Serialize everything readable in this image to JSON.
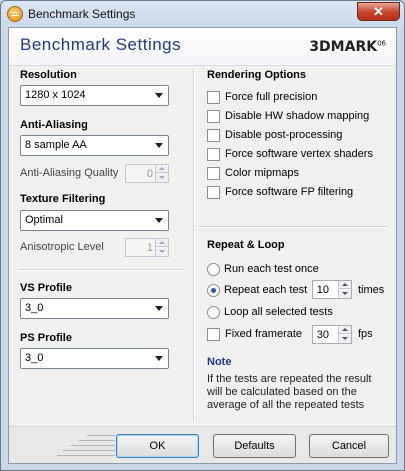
{
  "window": {
    "title": "Benchmark Settings",
    "close_label": "✕"
  },
  "header": {
    "title": "Benchmark Settings",
    "logo_main": "3DMARK",
    "logo_version": "06"
  },
  "left": {
    "resolution": {
      "label": "Resolution",
      "value": "1280 x 1024"
    },
    "anti_aliasing": {
      "label": "Anti-Aliasing",
      "value": "8 sample AA",
      "quality_label": "Anti-Aliasing Quality",
      "quality_value": "0"
    },
    "texture_filtering": {
      "label": "Texture Filtering",
      "value": "Optimal",
      "aniso_label": "Anisotropic Level",
      "aniso_value": "1"
    },
    "vs_profile": {
      "label": "VS Profile",
      "value": "3_0"
    },
    "ps_profile": {
      "label": "PS Profile",
      "value": "3_0"
    }
  },
  "rendering": {
    "title": "Rendering Options",
    "options": [
      {
        "label": "Force full precision",
        "checked": false
      },
      {
        "label": "Disable HW shadow mapping",
        "checked": false
      },
      {
        "label": "Disable post-processing",
        "checked": false
      },
      {
        "label": "Force software vertex shaders",
        "checked": false
      },
      {
        "label": "Color mipmaps",
        "checked": false
      },
      {
        "label": "Force software FP filtering",
        "checked": false
      }
    ]
  },
  "repeat": {
    "title": "Repeat & Loop",
    "once_label": "Run each test once",
    "repeat_label": "Repeat each test",
    "repeat_value": "10",
    "repeat_unit": "times",
    "loop_label": "Loop all selected tests",
    "fixed_label": "Fixed framerate",
    "fixed_value": "30",
    "fixed_unit": "fps",
    "selected": "repeat"
  },
  "note": {
    "title": "Note",
    "body": "If the tests are repeated the result will be calculated based on the average of all the repeated tests"
  },
  "buttons": {
    "ok": "OK",
    "defaults": "Defaults",
    "cancel": "Cancel"
  },
  "colors": {
    "accent": "#1f3a8a",
    "close": "#c7432a"
  }
}
